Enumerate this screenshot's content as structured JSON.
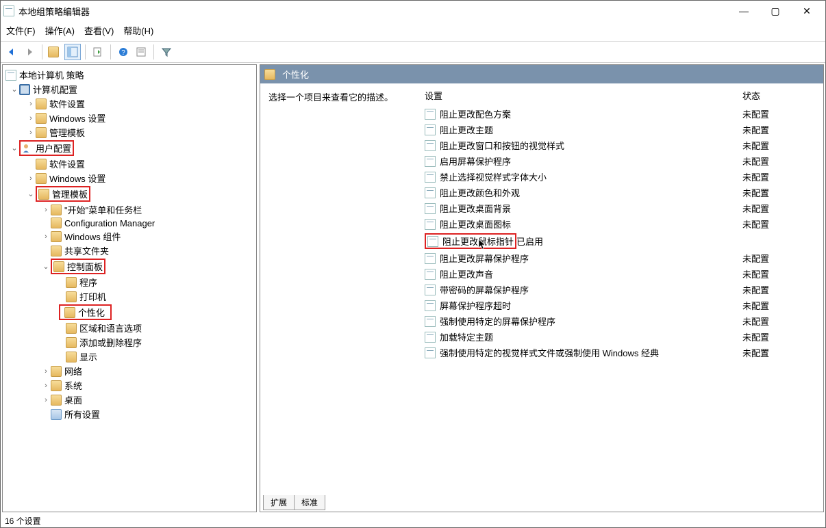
{
  "window": {
    "title": "本地组策略编辑器"
  },
  "menu": {
    "file": "文件(F)",
    "action": "操作(A)",
    "view": "查看(V)",
    "help": "帮助(H)"
  },
  "tree": {
    "root": "本地计算机 策略",
    "computer_config": "计算机配置",
    "cc_software": "软件设置",
    "cc_windows": "Windows 设置",
    "cc_admin": "管理模板",
    "user_config": "用户配置",
    "uc_software": "软件设置",
    "uc_windows": "Windows 设置",
    "uc_admin": "管理模板",
    "start_taskbar": "\"开始\"菜单和任务栏",
    "config_mgr": "Configuration Manager",
    "win_components": "Windows 组件",
    "shared_folders": "共享文件夹",
    "control_panel": "控制面板",
    "programs": "程序",
    "printers": "打印机",
    "personalization": "个性化",
    "region_lang": "区域和语言选项",
    "add_remove": "添加或删除程序",
    "display": "显示",
    "network": "网络",
    "system": "系统",
    "desktop": "桌面",
    "all_settings": "所有设置"
  },
  "right": {
    "path_title": "个性化",
    "desc_prompt": "选择一个项目来查看它的描述。",
    "col_setting": "设置",
    "col_state": "状态",
    "tab_ext": "扩展",
    "tab_std": "标准"
  },
  "settings": [
    {
      "label": "阻止更改配色方案",
      "state": "未配置"
    },
    {
      "label": "阻止更改主题",
      "state": "未配置"
    },
    {
      "label": "阻止更改窗口和按钮的视觉样式",
      "state": "未配置"
    },
    {
      "label": "启用屏幕保护程序",
      "state": "未配置"
    },
    {
      "label": "禁止选择视觉样式字体大小",
      "state": "未配置"
    },
    {
      "label": "阻止更改颜色和外观",
      "state": "未配置"
    },
    {
      "label": "阻止更改桌面背景",
      "state": "未配置"
    },
    {
      "label": "阻止更改桌面图标",
      "state": "未配置"
    },
    {
      "label": "阻止更改鼠标指针",
      "state": "已启用",
      "highlight": true
    },
    {
      "label": "阻止更改屏幕保护程序",
      "state": "未配置"
    },
    {
      "label": "阻止更改声音",
      "state": "未配置"
    },
    {
      "label": "带密码的屏幕保护程序",
      "state": "未配置"
    },
    {
      "label": "屏幕保护程序超时",
      "state": "未配置"
    },
    {
      "label": "强制使用特定的屏幕保护程序",
      "state": "未配置"
    },
    {
      "label": "加载特定主题",
      "state": "未配置"
    },
    {
      "label": "强制使用特定的视觉样式文件或强制使用 Windows 经典",
      "state": "未配置"
    }
  ],
  "status": {
    "count": "16 个设置"
  }
}
